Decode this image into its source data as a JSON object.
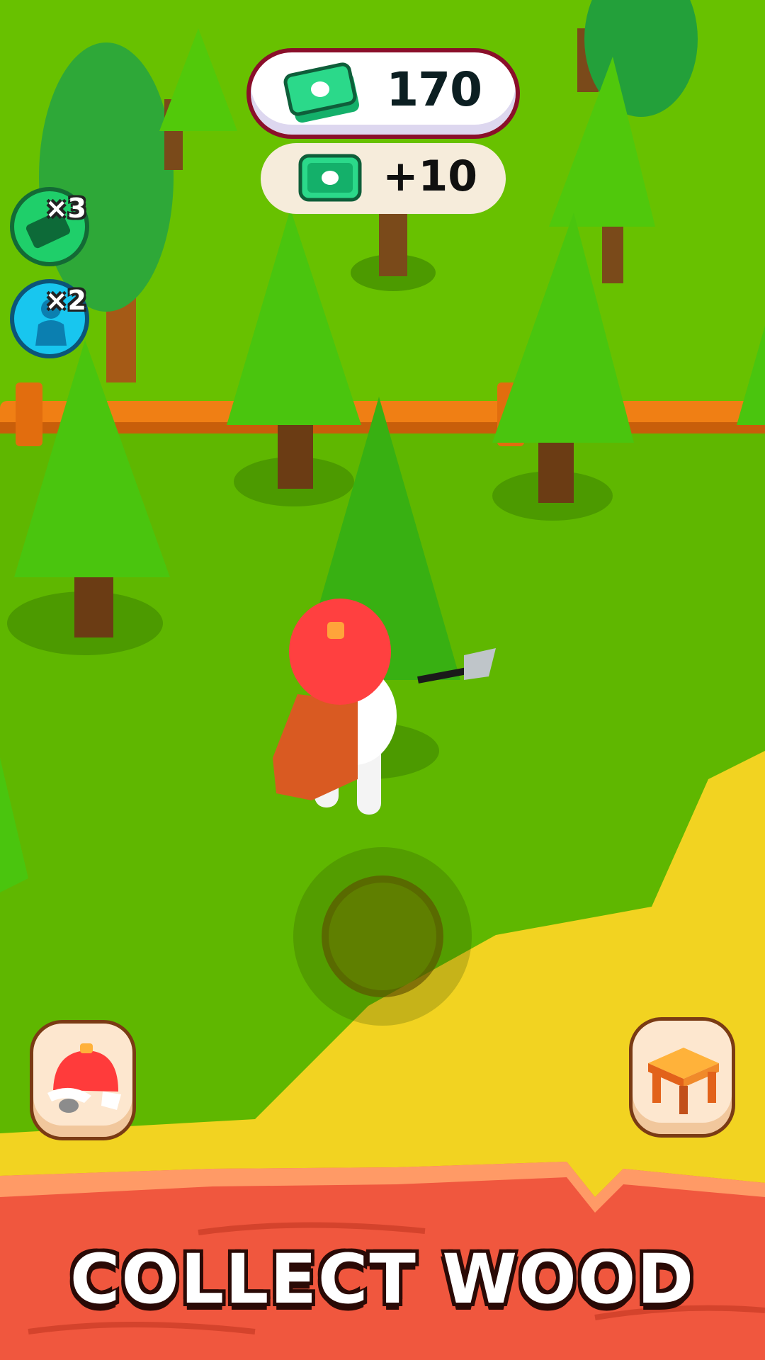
{
  "hud": {
    "cash": "170",
    "cash_icon": "cash-stack-icon",
    "income": "+10",
    "income_icon": "cash-bill-icon"
  },
  "boosters": [
    {
      "name": "cash-booster",
      "multiplier": "×3",
      "icon": "cash-icon",
      "color": "#1fcf6a"
    },
    {
      "name": "speed-booster",
      "multiplier": "×2",
      "icon": "worker-icon",
      "color": "#18c6ef"
    }
  ],
  "buttons": {
    "skins": "hat-icon",
    "build": "table-icon"
  },
  "banner": {
    "text": "COLLECT WOOD"
  },
  "colors": {
    "grass": "#5fb700",
    "sand": "#f2d321",
    "wood_banner": "#f0573e",
    "fence": "#f07f14",
    "tree": "#45c80a",
    "player_hat": "#ff4040"
  }
}
